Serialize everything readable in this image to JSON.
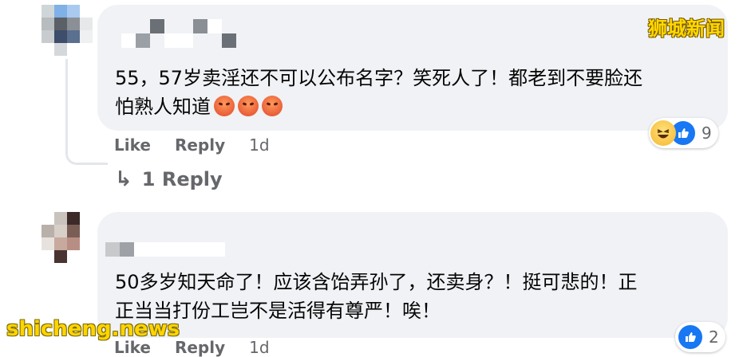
{
  "comments": [
    {
      "text_line1": "55，57岁卖淫还不可以公布名字？笑死人了！都老到不要脸还",
      "text_line2": "怕熟人知道",
      "actions": {
        "like": "Like",
        "reply": "Reply",
        "time": "1d"
      },
      "reaction_count": "9",
      "reactions": [
        "haha",
        "like"
      ]
    },
    {
      "text_line1": "50多岁知天命了！应该含饴弄孙了，还卖身？！挺可悲的！正",
      "text_line2": "正当当打份工岂不是活得有尊严！唉！",
      "actions": {
        "like": "Like",
        "reply": "Reply",
        "time": "1d"
      },
      "reaction_count": "2",
      "reactions": [
        "like"
      ]
    }
  ],
  "replies_link": {
    "arrow": "↳",
    "label": "1 Reply"
  },
  "watermarks": {
    "top": "狮城新闻",
    "bottom": "shicheng.news"
  },
  "colors": {
    "bubble": "#f0f2f5",
    "muted": "#65676b",
    "like_blue": "#1877f2",
    "watermark": "#ffd800"
  }
}
